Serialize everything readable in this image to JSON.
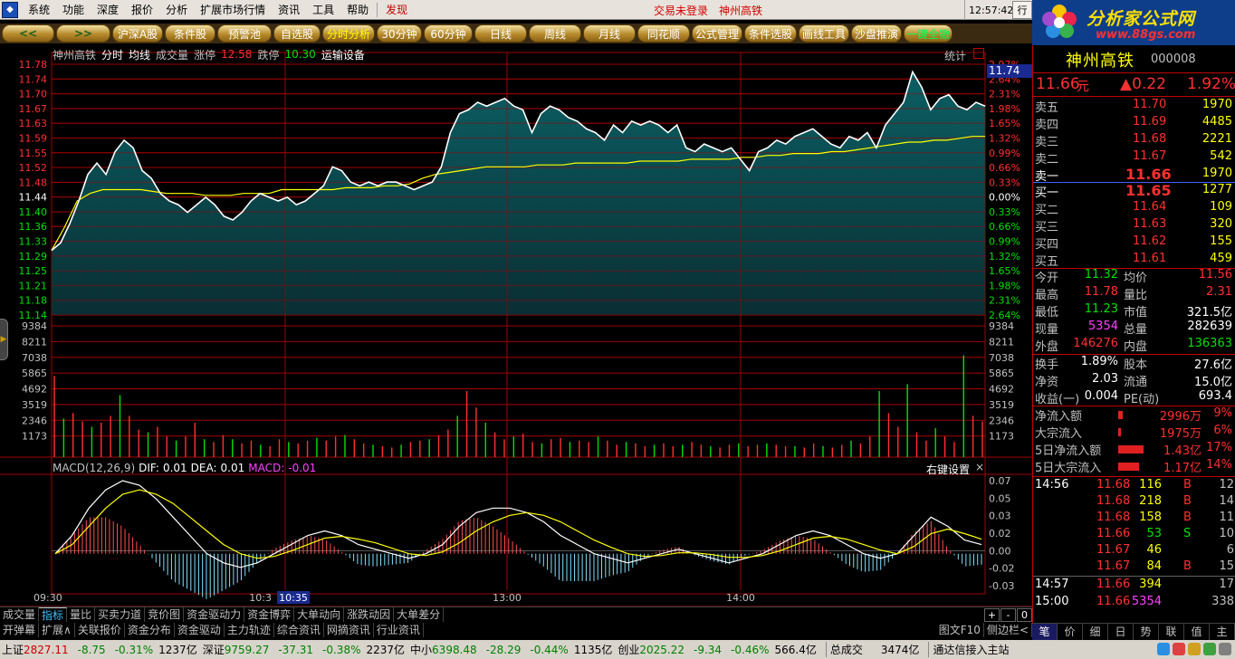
{
  "menu": {
    "items": [
      "系统",
      "功能",
      "深度",
      "报价",
      "分析",
      "扩展市场行情",
      "资讯",
      "工具",
      "帮助"
    ],
    "discover": "发现",
    "center": "交易未登录　神州高铁",
    "clock": "12:57:42 周六",
    "right_btn": "行"
  },
  "logo": {
    "title": "分析家公式网",
    "url": "www.88gs.com"
  },
  "tabs": [
    "沪深A股",
    "条件股",
    "预警池",
    "自选股",
    "分时分析",
    "30分钟",
    "60分钟",
    "日线",
    "周线",
    "月线",
    "同花顺",
    "公式管理",
    "条件选股",
    "画线工具",
    "沙盘推演",
    "一键全撤"
  ],
  "tab_active": "分时分析",
  "tab_arrow_left": "<<",
  "tab_arrow_right": ">>",
  "chart_header": {
    "name": "神州高铁",
    "t1": "分时",
    "t2": "均线",
    "t3": "成交量",
    "zt_label": "涨停",
    "zt_value": "12.58",
    "dt_label": "跌停",
    "dt_value": "10.30",
    "sector": "运输设备",
    "stat": "统计",
    "ref_price": "11.74"
  },
  "macd_header": {
    "name": "MACD(12,26,9)",
    "dif_label": "DIF:",
    "dif": "0.01",
    "dea_label": "DEA:",
    "dea": "0.01",
    "macd_label": "MACD:",
    "macd": "-0.01",
    "settings": "右键设置",
    "close": "×"
  },
  "time_axis": {
    "labels": [
      "09:30",
      "10:3",
      "13:00",
      "14:00"
    ],
    "cursor": "10:35"
  },
  "price_axis": {
    "left": [
      "11.78",
      "11.74",
      "11.70",
      "11.67",
      "11.63",
      "11.59",
      "11.55",
      "11.52",
      "11.48",
      "11.44",
      "11.40",
      "11.36",
      "11.33",
      "11.29",
      "11.25",
      "11.21",
      "11.18",
      "11.14"
    ],
    "right": [
      "2.97%",
      "2.64%",
      "2.31%",
      "1.98%",
      "1.65%",
      "1.32%",
      "0.99%",
      "0.66%",
      "0.33%",
      "0.00%",
      "0.33%",
      "0.66%",
      "0.99%",
      "1.32%",
      "1.65%",
      "1.98%",
      "2.31%",
      "2.64%"
    ],
    "vol": [
      "9384",
      "8211",
      "7038",
      "5865",
      "4692",
      "3519",
      "2346",
      "1173"
    ],
    "macd": [
      "0.07",
      "0.05",
      "0.03",
      "0.02",
      "0.00",
      "-0.02",
      "-0.03"
    ]
  },
  "colors": {
    "up": "#ff3030",
    "down": "#00e000",
    "grid": "#a00000",
    "area": "#0b5f63",
    "price_line": "#ffffff",
    "avg_line": "#ffff00",
    "dif_line": "#ffffff",
    "dea_line": "#ffff00"
  },
  "chart_data": {
    "type": "line",
    "prev_close": 11.44,
    "ylim": [
      11.1,
      11.78
    ],
    "price": [
      11.29,
      11.31,
      11.36,
      11.42,
      11.49,
      11.52,
      11.49,
      11.55,
      11.58,
      11.56,
      11.5,
      11.48,
      11.44,
      11.42,
      11.41,
      11.39,
      11.41,
      11.43,
      11.41,
      11.38,
      11.37,
      11.39,
      11.42,
      11.44,
      11.43,
      11.42,
      11.43,
      11.41,
      11.42,
      11.44,
      11.46,
      11.51,
      11.5,
      11.47,
      11.46,
      11.47,
      11.46,
      11.47,
      11.47,
      11.46,
      11.45,
      11.46,
      11.47,
      11.51,
      11.6,
      11.65,
      11.66,
      11.68,
      11.67,
      11.68,
      11.69,
      11.67,
      11.66,
      11.6,
      11.65,
      11.67,
      11.66,
      11.64,
      11.63,
      11.61,
      11.6,
      11.58,
      11.62,
      11.6,
      11.63,
      11.62,
      11.63,
      11.62,
      11.6,
      11.62,
      11.56,
      11.55,
      11.57,
      11.56,
      11.55,
      11.56,
      11.53,
      11.5,
      11.55,
      11.56,
      11.58,
      11.57,
      11.59,
      11.6,
      11.61,
      11.59,
      11.57,
      11.56,
      11.59,
      11.58,
      11.6,
      11.56,
      11.62,
      11.65,
      11.68,
      11.76,
      11.72,
      11.66,
      11.69,
      11.7,
      11.67,
      11.66,
      11.68,
      11.67
    ],
    "avg": [
      11.29,
      11.35,
      11.42,
      11.44,
      11.45,
      11.45,
      11.45,
      11.45,
      11.445,
      11.44,
      11.44,
      11.44,
      11.435,
      11.435,
      11.435,
      11.44,
      11.44,
      11.44,
      11.45,
      11.45,
      11.45,
      11.45,
      11.45,
      11.455,
      11.455,
      11.455,
      11.46,
      11.46,
      11.465,
      11.48,
      11.49,
      11.495,
      11.5,
      11.505,
      11.51,
      11.51,
      11.51,
      11.51,
      11.515,
      11.515,
      11.515,
      11.52,
      11.52,
      11.52,
      11.52,
      11.52,
      11.525,
      11.525,
      11.525,
      11.525,
      11.53,
      11.53,
      11.53,
      11.53,
      11.535,
      11.535,
      11.54,
      11.54,
      11.545,
      11.545,
      11.545,
      11.55,
      11.55,
      11.555,
      11.56,
      11.565,
      11.57,
      11.575,
      11.575,
      11.58,
      11.58,
      11.585,
      11.59,
      11.59
    ],
    "volume": [
      5900,
      2800,
      3200,
      2600,
      2200,
      2500,
      3000,
      4500,
      3000,
      2000,
      1800,
      2200,
      1500,
      1200,
      1500,
      2500,
      1300,
      1100,
      1600,
      1300,
      1000,
      1200,
      900,
      800,
      1300,
      1100,
      1000,
      1200,
      1400,
      1200,
      1500,
      1600,
      1300,
      1000,
      900,
      800,
      700,
      900,
      1100,
      1200,
      1300,
      1600,
      2000,
      3000,
      4800,
      3600,
      2500,
      1800,
      1300,
      1500,
      1700,
      1100,
      1000,
      1300,
      1400,
      1100,
      1200,
      1100,
      1500,
      1200,
      900,
      1100,
      1000,
      800,
      900,
      1000,
      800,
      900,
      1100,
      900,
      800,
      700,
      900,
      1000,
      800,
      900,
      1000,
      900,
      800,
      800,
      700,
      1000,
      800,
      700,
      900,
      1200,
      1000,
      1500,
      4800,
      3200,
      2200,
      5300,
      1800,
      1200,
      2100,
      1500,
      1100,
      7400,
      3000,
      2600
    ],
    "macd": {
      "dif": [
        0.0,
        0.02,
        0.05,
        0.07,
        0.08,
        0.075,
        0.06,
        0.04,
        0.02,
        0.0,
        -0.01,
        -0.015,
        -0.01,
        0.0,
        0.01,
        0.02,
        0.025,
        0.02,
        0.01,
        0.005,
        0.0,
        -0.005,
        0.0,
        0.01,
        0.03,
        0.045,
        0.05,
        0.05,
        0.045,
        0.035,
        0.02,
        0.01,
        0.0,
        -0.005,
        -0.01,
        -0.005,
        0.0,
        0.005,
        0.0,
        -0.005,
        -0.01,
        -0.005,
        0.0,
        0.01,
        0.02,
        0.025,
        0.02,
        0.01,
        0.0,
        -0.005,
        0.0,
        0.02,
        0.04,
        0.03,
        0.015,
        0.01
      ],
      "dea": [
        0.0,
        0.01,
        0.03,
        0.05,
        0.065,
        0.07,
        0.065,
        0.055,
        0.04,
        0.025,
        0.01,
        0.0,
        -0.005,
        -0.003,
        0.003,
        0.01,
        0.017,
        0.019,
        0.016,
        0.012,
        0.006,
        0.0,
        -0.002,
        0.002,
        0.012,
        0.025,
        0.035,
        0.042,
        0.045,
        0.042,
        0.035,
        0.025,
        0.015,
        0.007,
        0.0,
        -0.003,
        -0.002,
        0.001,
        0.001,
        -0.001,
        -0.004,
        -0.004,
        -0.002,
        0.003,
        0.01,
        0.017,
        0.019,
        0.016,
        0.01,
        0.004,
        0.0,
        0.008,
        0.022,
        0.027,
        0.022,
        0.016
      ],
      "ylim": [
        -0.035,
        0.08
      ]
    }
  },
  "quote": {
    "name": "神州高铁",
    "code": "000008",
    "price": "11.66",
    "unit": "元",
    "change": "▲0.22",
    "pct": "1.92%",
    "asks": [
      {
        "label": "卖五",
        "price": "11.70",
        "vol": "1970"
      },
      {
        "label": "卖四",
        "price": "11.69",
        "vol": "4485"
      },
      {
        "label": "卖三",
        "price": "11.68",
        "vol": "2221"
      },
      {
        "label": "卖二",
        "price": "11.67",
        "vol": "542"
      },
      {
        "label": "卖一",
        "price": "11.66",
        "vol": "1970"
      }
    ],
    "bids": [
      {
        "label": "买一",
        "price": "11.65",
        "vol": "1277"
      },
      {
        "label": "买二",
        "price": "11.64",
        "vol": "109"
      },
      {
        "label": "买三",
        "price": "11.63",
        "vol": "320"
      },
      {
        "label": "买四",
        "price": "11.62",
        "vol": "155"
      },
      {
        "label": "买五",
        "price": "11.61",
        "vol": "459"
      }
    ],
    "stats": [
      {
        "l1": "今开",
        "v1": "11.32",
        "c1": "grn",
        "l2": "均价",
        "v2": "11.56",
        "c2": "red"
      },
      {
        "l1": "最高",
        "v1": "11.78",
        "c1": "red",
        "l2": "量比",
        "v2": "2.31",
        "c2": "red"
      },
      {
        "l1": "最低",
        "v1": "11.23",
        "c1": "grn",
        "l2": "市值",
        "v2": "321.5亿",
        "c2": "wht"
      },
      {
        "l1": "现量",
        "v1": "5354",
        "c1": "mag",
        "l2": "总量",
        "v2": "282639",
        "c2": "wht"
      },
      {
        "l1": "外盘",
        "v1": "146276",
        "c1": "red",
        "l2": "内盘",
        "v2": "136363",
        "c2": "grn"
      }
    ],
    "stats2": [
      {
        "l1": "换手",
        "v1": "1.89%",
        "l2": "股本",
        "v2": "27.6亿"
      },
      {
        "l1": "净资",
        "v1": "2.03",
        "l2": "流通",
        "v2": "15.0亿"
      },
      {
        "l1": "收益(一)",
        "v1": "0.004",
        "l2": "PE(动)",
        "v2": "693.4"
      }
    ],
    "flows": [
      {
        "label": "净流入额",
        "val": "2996万",
        "pct": "9%",
        "bar": 0.1
      },
      {
        "label": "大宗流入",
        "val": "1975万",
        "pct": "6%",
        "bar": 0.06
      },
      {
        "label": "5日净流入额",
        "val": "1.43亿",
        "pct": "17%",
        "bar": 0.55
      },
      {
        "label": "5日大宗流入",
        "val": "1.17亿",
        "pct": "14%",
        "bar": 0.45
      }
    ],
    "ticks": [
      {
        "time": "14:56",
        "price": "11.68",
        "vol": "116",
        "bs": "B",
        "n": "12"
      },
      {
        "time": "",
        "price": "11.68",
        "vol": "218",
        "bs": "B",
        "n": "14"
      },
      {
        "time": "",
        "price": "11.68",
        "vol": "158",
        "bs": "B",
        "n": "11"
      },
      {
        "time": "",
        "price": "11.66",
        "vol": "53",
        "bs": "S",
        "n": "10"
      },
      {
        "time": "",
        "price": "11.67",
        "vol": "46",
        "bs": "",
        "n": "6"
      },
      {
        "time": "",
        "price": "11.67",
        "vol": "84",
        "bs": "B",
        "n": "15"
      },
      {
        "time": "14:57",
        "price": "11.66",
        "vol": "394",
        "bs": "",
        "n": "17"
      },
      {
        "time": "15:00",
        "price": "11.66",
        "vol": "5354",
        "bs": "",
        "n": "338"
      }
    ]
  },
  "bottom_tabs": [
    "成交量",
    "指标",
    "量比",
    "买卖力道",
    "竞价图",
    "资金驱动力",
    "资金博弈",
    "大单动向",
    "涨跌动因",
    "大单差分"
  ],
  "bottom_tab_selected": "指标",
  "bottom_ctl": [
    "+",
    "-",
    "0"
  ],
  "func_bar": [
    "开弹幕",
    "扩展∧",
    "关联报价",
    "资金分布",
    "资金驱动",
    "主力轨迹",
    "综合资讯",
    "网摘资讯",
    "行业资讯"
  ],
  "func_right": [
    "图文F10",
    "侧边栏<"
  ],
  "right_tabs": [
    "笔",
    "价",
    "细",
    "日",
    "势",
    "联",
    "值",
    "主"
  ],
  "status": {
    "sh_label": "上证",
    "sh": "2827.11",
    "sh_chg": "-8.75",
    "sh_pct": "-0.31%",
    "sh_amt": "1237亿",
    "sz_label": "深证",
    "sz": "9759.27",
    "sz_chg": "-37.31",
    "sz_pct": "-0.38%",
    "sz_amt": "2237亿",
    "zx_label": "中小",
    "zx": "6398.48",
    "zx_chg": "-28.29",
    "zx_pct": "-0.44%",
    "zx_amt": "1135亿",
    "cy_label": "创业",
    "cy": "2025.22",
    "cy_chg": "-9.34",
    "cy_pct": "-0.46%",
    "cy_amt": "566.4亿",
    "total_label": "总成交",
    "total": "3474亿",
    "conn": "通达信接入主站"
  }
}
